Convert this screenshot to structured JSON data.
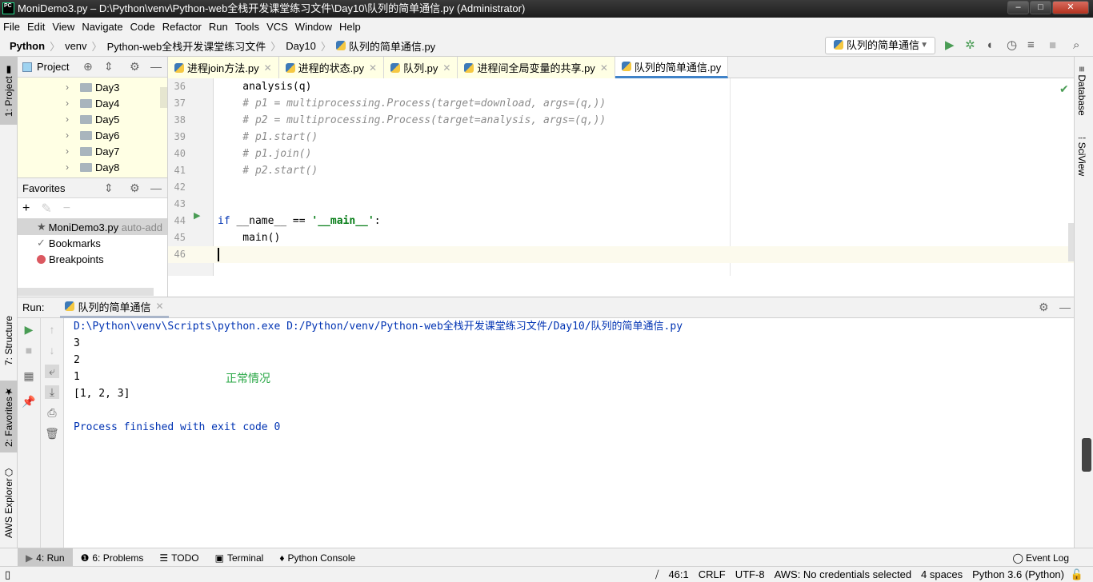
{
  "window": {
    "title": "MoniDemo3.py – D:\\Python\\venv\\Python-web全栈开发课堂练习文件\\Day10\\队列的简单通信.py (Administrator)",
    "logo": "PC"
  },
  "menu": [
    "File",
    "Edit",
    "View",
    "Navigate",
    "Code",
    "Refactor",
    "Run",
    "Tools",
    "VCS",
    "Window",
    "Help"
  ],
  "breadcrumb": [
    "Python",
    "venv",
    "Python-web全栈开发课堂练习文件",
    "Day10",
    "队列的简单通信.py"
  ],
  "run_config": "队列的简单通信",
  "left_stripe": {
    "project": "1: Project",
    "structure": "7: Structure",
    "favorites": "2: Favorites",
    "aws": "AWS Explorer"
  },
  "right_stripe": {
    "database": "Database",
    "sciview": "SciView"
  },
  "project_panel": {
    "title": "Project",
    "folders": [
      "Day3",
      "Day4",
      "Day5",
      "Day6",
      "Day7",
      "Day8"
    ]
  },
  "favorites": {
    "title": "Favorites",
    "items": [
      {
        "label": "MoniDemo3.py",
        "note": "auto-add"
      },
      {
        "label": "Bookmarks"
      },
      {
        "label": "Breakpoints"
      }
    ]
  },
  "tabs": [
    "进程join方法.py",
    "进程的状态.py",
    "队列.py",
    "进程间全局变量的共享.py",
    "队列的简单通信.py"
  ],
  "active_tab": 4,
  "code": [
    {
      "n": "36",
      "segs": [
        [
          "",
          "    analysis(q)"
        ]
      ]
    },
    {
      "n": "37",
      "segs": [
        [
          "cm",
          "    # p1 = multiprocessing.Process(target=download, args=(q,))"
        ]
      ]
    },
    {
      "n": "38",
      "segs": [
        [
          "cm",
          "    # p2 = multiprocessing.Process(target=analysis, args=(q,))"
        ]
      ]
    },
    {
      "n": "39",
      "segs": [
        [
          "cm",
          "    # p1.start()"
        ]
      ]
    },
    {
      "n": "40",
      "segs": [
        [
          "cm",
          "    # p1.join()"
        ]
      ]
    },
    {
      "n": "41",
      "segs": [
        [
          "cm",
          "    # p2.start()"
        ]
      ]
    },
    {
      "n": "42",
      "segs": []
    },
    {
      "n": "43",
      "segs": []
    },
    {
      "n": "44",
      "segs": [
        [
          "kw",
          "if"
        ],
        [
          "",
          " __name__ == "
        ],
        [
          "st",
          "'__main__'"
        ],
        [
          "",
          ":"
        ]
      ]
    },
    {
      "n": "45",
      "segs": [
        [
          "",
          "    main()"
        ]
      ]
    },
    {
      "n": "46",
      "segs": []
    }
  ],
  "run": {
    "label": "Run:",
    "tab": "队列的简单通信",
    "output": [
      "D:\\Python\\venv\\Scripts\\python.exe D:/Python/venv/Python-web全栈开发课堂练习文件/Day10/队列的简单通信.py",
      "3",
      "2",
      "1",
      "[1, 2, 3]",
      "",
      "Process finished with exit code 0"
    ],
    "annotation": "正常情况"
  },
  "bottom_tools": [
    "4: Run",
    "6: Problems",
    "TODO",
    "Terminal",
    "Python Console"
  ],
  "event_log": "Event Log",
  "status": {
    "position": "46:1",
    "line_sep": "CRLF",
    "encoding": "UTF-8",
    "aws": "AWS: No credentials selected",
    "indent": "4 spaces",
    "interpreter": "Python 3.6 (Python)"
  },
  "colors": {
    "accent": "#4083c9",
    "run_green": "#499c54",
    "console_blue": "#0033b3",
    "annotation_green": "#28a745"
  }
}
